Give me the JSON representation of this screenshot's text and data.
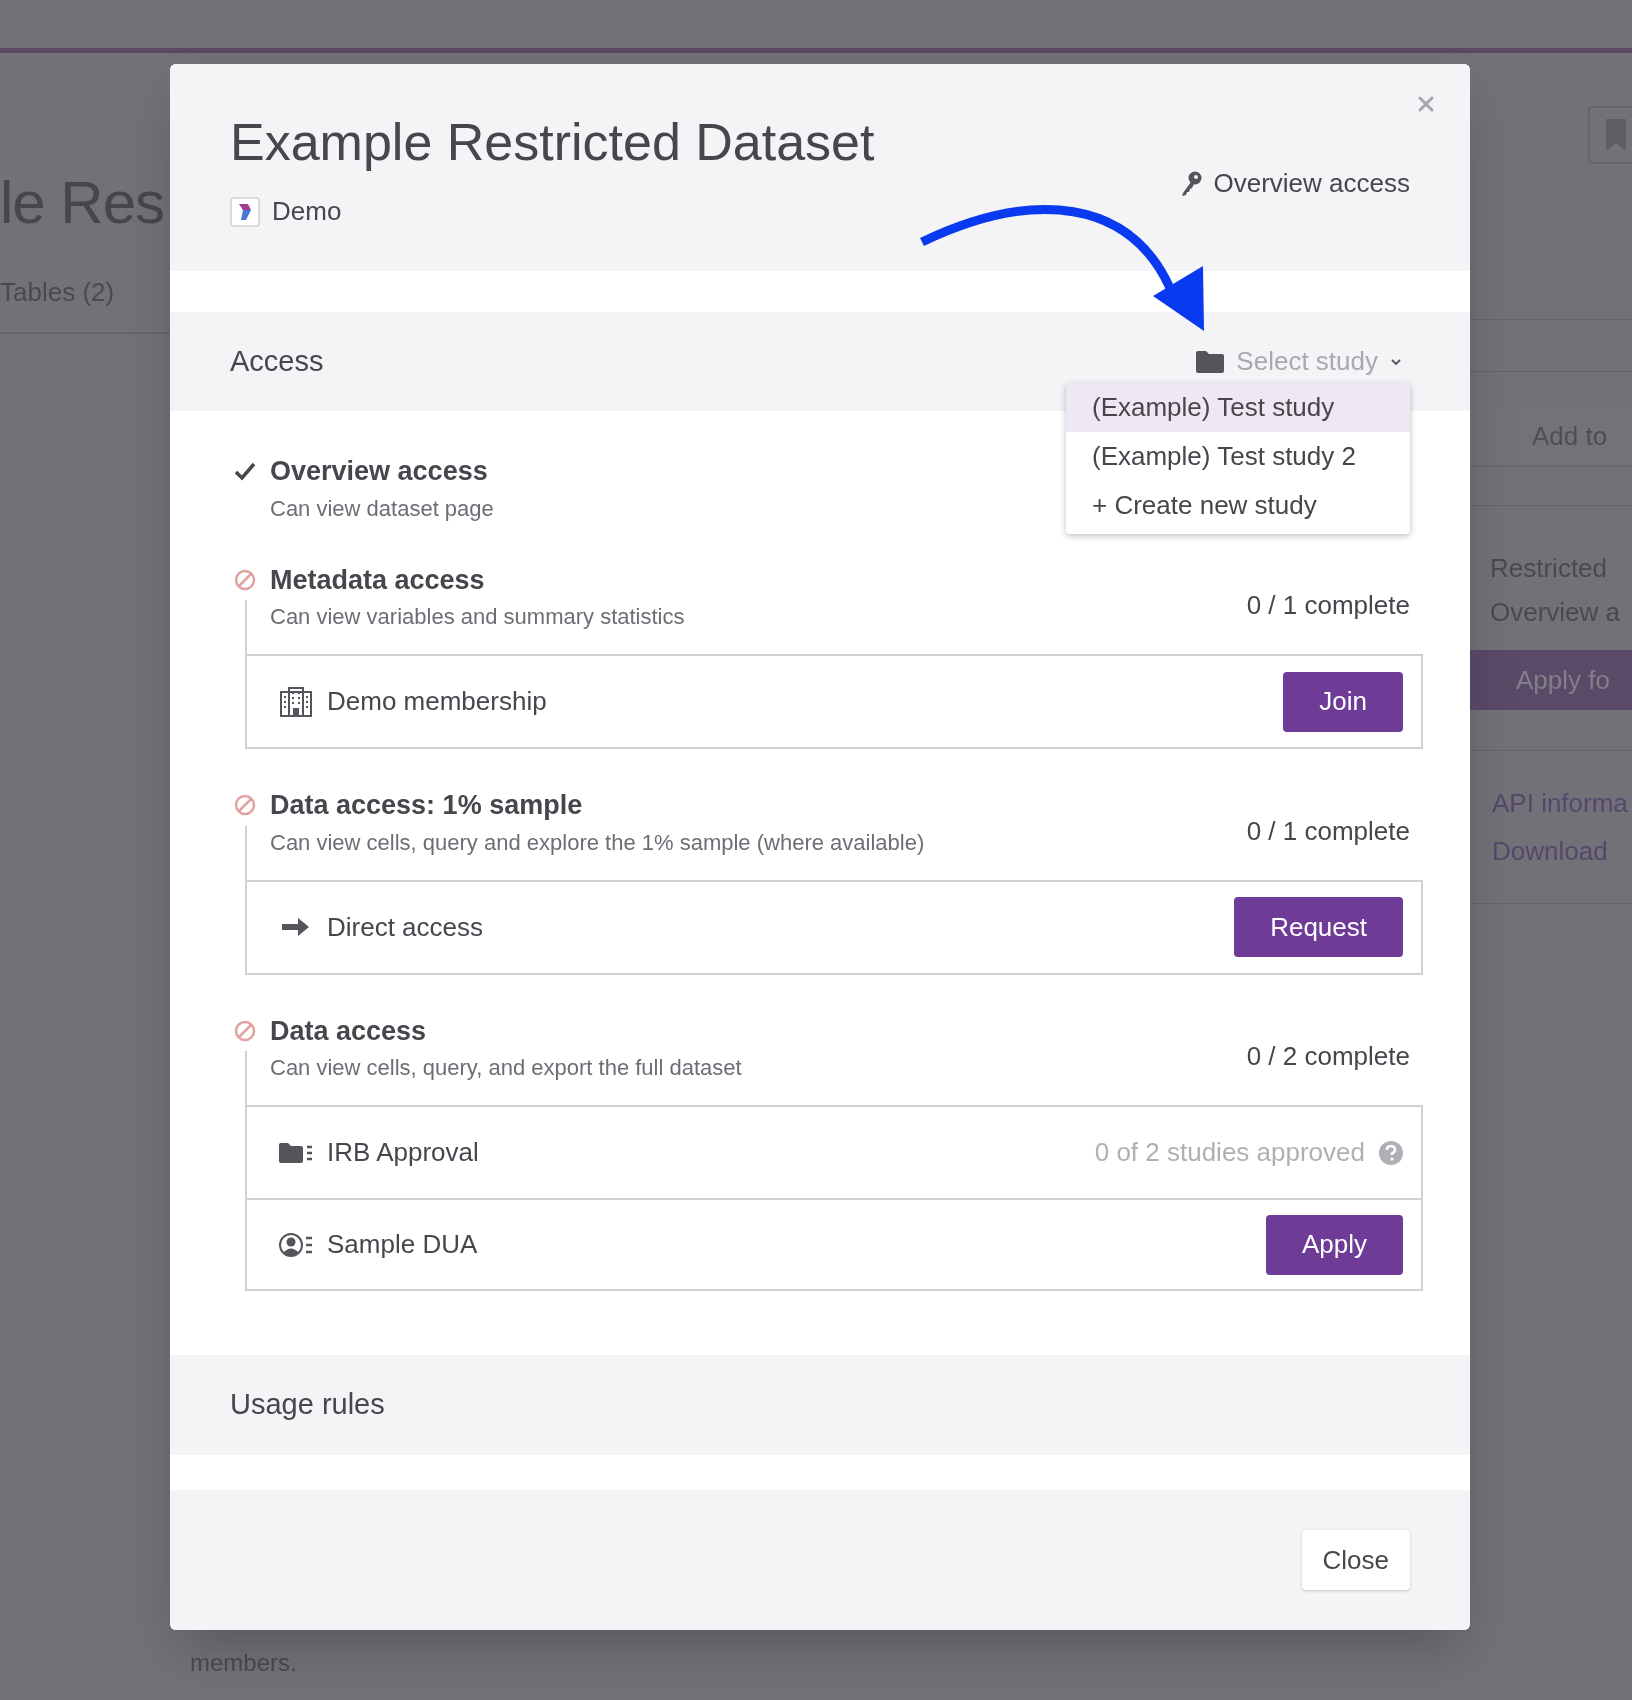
{
  "background_page": {
    "title": "le Res",
    "tab": "Tables (2)",
    "add_field": "Add to",
    "side_lines": [
      "Restricted",
      "Overview a"
    ],
    "apply_button": "Apply fo",
    "links": [
      "API informa",
      "Download"
    ],
    "footer_text": "members."
  },
  "modal": {
    "title": "Example Restricted Dataset",
    "organization": "Demo",
    "current_access": "Overview access",
    "access": {
      "heading": "Access",
      "study_select": {
        "placeholder": "Select study",
        "options": [
          {
            "label": "(Example) Test study",
            "selected": true
          },
          {
            "label": "(Example) Test study 2",
            "selected": false
          },
          {
            "label": "+ Create new study",
            "selected": false
          }
        ]
      },
      "levels": [
        {
          "name": "Overview access",
          "description": "Can view dataset page",
          "granted": true
        },
        {
          "name": "Metadata access",
          "description": "Can view variables and summary statistics",
          "granted": false,
          "progress": "0 / 1 complete",
          "requirements": [
            {
              "kind": "membership",
              "label": "Demo membership",
              "action": "Join"
            }
          ]
        },
        {
          "name": "Data access: 1% sample",
          "description": "Can view cells, query and explore the 1% sample (where available)",
          "granted": false,
          "progress": "0 / 1 complete",
          "requirements": [
            {
              "kind": "direct",
              "label": "Direct access",
              "action": "Request"
            }
          ]
        },
        {
          "name": "Data access",
          "description": "Can view cells, query, and export the full dataset",
          "granted": false,
          "progress": "0 / 2 complete",
          "requirements": [
            {
              "kind": "irb",
              "label": "IRB Approval",
              "status": "0 of 2 studies approved"
            },
            {
              "kind": "dua",
              "label": "Sample DUA",
              "action": "Apply"
            }
          ]
        }
      ]
    },
    "usage_rules": {
      "heading": "Usage rules"
    },
    "close_button": "Close"
  }
}
